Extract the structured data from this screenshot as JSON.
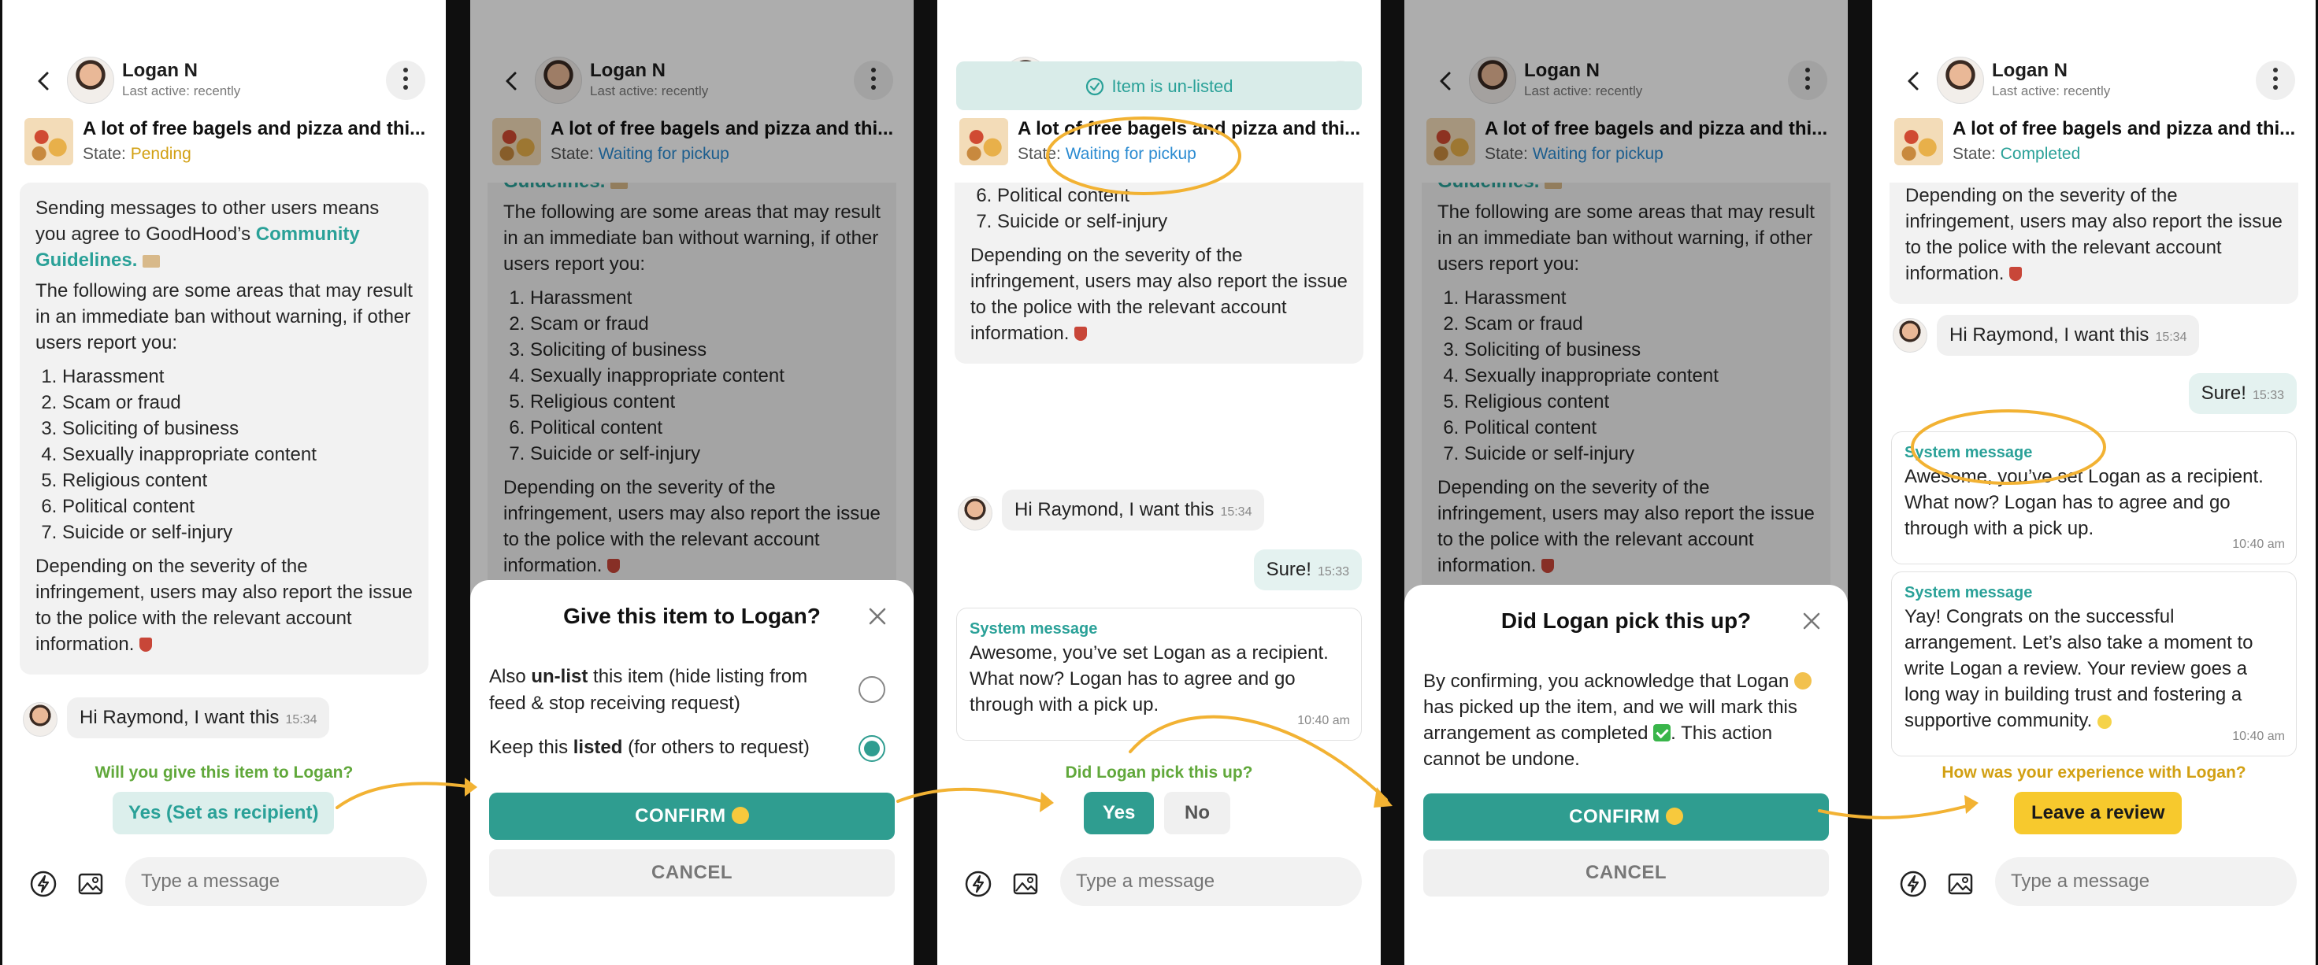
{
  "header": {
    "user_name": "Logan N",
    "user_status": "Last active: recently",
    "item_title": "A lot of free bagels and pizza and thi...",
    "state_label": "State:"
  },
  "states": {
    "pending": "Pending",
    "waiting": "Waiting for pickup",
    "completed": "Completed"
  },
  "colors": {
    "accent": "#2aa198",
    "pending": "#d2a013",
    "waiting": "#2b8bd1",
    "completed": "#2aa198",
    "annotation": "#f2b233"
  },
  "guidelines": {
    "intro_1": "Sending messages to other users means you agree to GoodHood’s ",
    "link": "Community Guidelines",
    "partial_link": "Guidelines.",
    "intro_2": "The following are some areas that may result in an immediate ban without warning, if other users report you:",
    "items": [
      "Harassment",
      "Scam or fraud",
      "Soliciting of business",
      "Sexually inappropriate content",
      "Religious content",
      "Political content",
      "Suicide or self-injury"
    ],
    "outro": "Depending on the severity of the infringement, users may also report the issue to the police with the relevant account information."
  },
  "messages": {
    "request": "Hi Raymond, I want this",
    "request_time": "15:34",
    "reply": "Sure!",
    "reply_time": "15:33",
    "system_title": "System message",
    "system_1": "Awesome, you’ve set Logan as a recipient. What now? Logan has to agree and go through with a pick up.",
    "system_1_time": "10:40 am",
    "system_2": "Yay! Congrats on the successful arrangement. Let’s also take a moment to write Logan a review. Your review goes a long way in building trust and fostering a supportive community.",
    "system_2_time": "10:40 am"
  },
  "panel1": {
    "prompt": "Will you give this item to Logan?",
    "button": "Yes (Set as recipient)"
  },
  "panel2": {
    "sheet_title": "Give this item to Logan?",
    "option_unlist_pre": "Also ",
    "option_unlist_bold": "un-list",
    "option_unlist_post": " this item (hide listing from feed & stop receiving request)",
    "option_keep_pre": "Keep this ",
    "option_keep_bold": "listed",
    "option_keep_post": " (for others to request)",
    "selected_option": "keep-listed",
    "confirm": "CONFIRM",
    "cancel": "CANCEL"
  },
  "panel3": {
    "toast": "Item is un-listed",
    "prompt": "Did Logan pick this up?",
    "yes": "Yes",
    "no": "No"
  },
  "panel4": {
    "sheet_title": "Did Logan pick this up?",
    "text_1": "By confirming, you acknowledge that Logan",
    "text_2": "has picked up the item, and we will mark this arrangement as completed",
    "text_3": ". This action cannot be undone.",
    "confirm": "CONFIRM",
    "cancel": "CANCEL"
  },
  "panel5": {
    "prompt": "How was your experience with Logan?",
    "button": "Leave a review"
  },
  "composer": {
    "placeholder": "Type a message"
  }
}
